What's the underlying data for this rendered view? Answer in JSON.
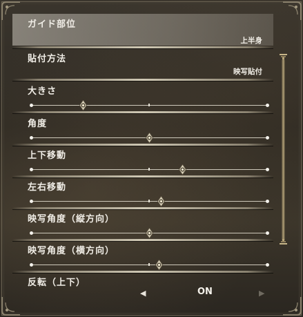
{
  "options": [
    {
      "label": "ガイド部位",
      "value": "上半身"
    },
    {
      "label": "貼付方法",
      "value": "映写貼付"
    },
    {
      "label": "大きさ",
      "slider": 0.22
    },
    {
      "label": "角度",
      "slider": 0.5
    },
    {
      "label": "上下移動",
      "slider": 0.64
    },
    {
      "label": "左右移動",
      "slider": 0.55
    },
    {
      "label": "映写角度（縦方向）",
      "slider": 0.5
    },
    {
      "label": "映写角度（横方向）",
      "slider": 0.54
    },
    {
      "label": "反転（上下）",
      "value": "ON"
    }
  ],
  "colors": {
    "selected_row": "#c8c3b9",
    "text": "#f0ede6",
    "accent": "#b5a379"
  },
  "icons": {
    "left": "arrow-left-icon",
    "right": "arrow-right-icon",
    "knob": "slider-knob-icon"
  }
}
